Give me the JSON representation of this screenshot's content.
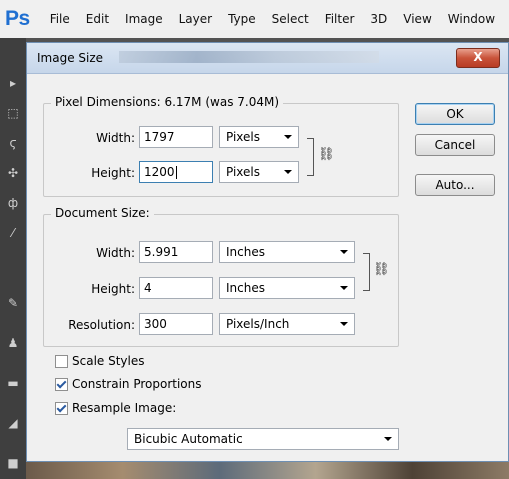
{
  "app": {
    "logo": "Ps",
    "menu": [
      "File",
      "Edit",
      "Image",
      "Layer",
      "Type",
      "Select",
      "Filter",
      "3D",
      "View",
      "Window"
    ]
  },
  "dialog": {
    "title": "Image Size",
    "close_label": "X",
    "pixel_dimensions": {
      "legend": "Pixel Dimensions:  6.17M (was 7.04M)",
      "width_label": "Width:",
      "width_value": "1797",
      "width_unit": "Pixels",
      "height_label": "Height:",
      "height_value": "1200",
      "height_unit": "Pixels"
    },
    "document_size": {
      "legend": "Document Size:",
      "width_label": "Width:",
      "width_value": "5.991",
      "width_unit": "Inches",
      "height_label": "Height:",
      "height_value": "4",
      "height_unit": "Inches",
      "resolution_label": "Resolution:",
      "resolution_value": "300",
      "resolution_unit": "Pixels/Inch"
    },
    "buttons": {
      "ok": "OK",
      "cancel": "Cancel",
      "auto": "Auto..."
    },
    "options": {
      "scale_styles": {
        "label": "Scale Styles",
        "checked": false
      },
      "constrain_proportions": {
        "label": "Constrain Proportions",
        "checked": true
      },
      "resample_image": {
        "label": "Resample Image:",
        "checked": true
      },
      "resample_method": "Bicubic Automatic"
    }
  }
}
